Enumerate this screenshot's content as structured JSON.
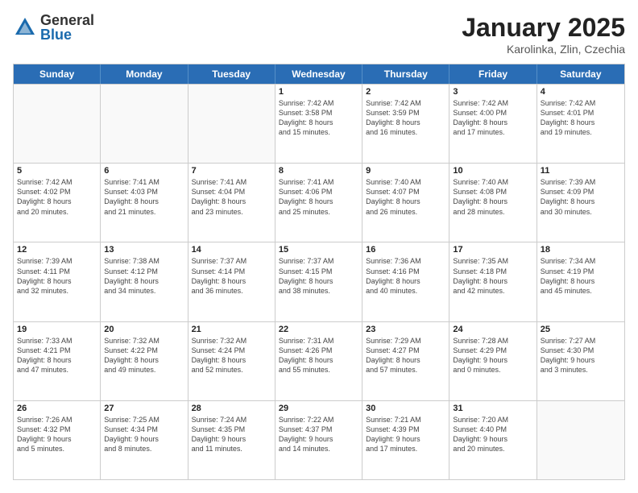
{
  "logo": {
    "general": "General",
    "blue": "Blue"
  },
  "title": "January 2025",
  "location": "Karolinka, Zlin, Czechia",
  "days": [
    "Sunday",
    "Monday",
    "Tuesday",
    "Wednesday",
    "Thursday",
    "Friday",
    "Saturday"
  ],
  "weeks": [
    [
      {
        "day": "",
        "info": ""
      },
      {
        "day": "",
        "info": ""
      },
      {
        "day": "",
        "info": ""
      },
      {
        "day": "1",
        "info": "Sunrise: 7:42 AM\nSunset: 3:58 PM\nDaylight: 8 hours\nand 15 minutes."
      },
      {
        "day": "2",
        "info": "Sunrise: 7:42 AM\nSunset: 3:59 PM\nDaylight: 8 hours\nand 16 minutes."
      },
      {
        "day": "3",
        "info": "Sunrise: 7:42 AM\nSunset: 4:00 PM\nDaylight: 8 hours\nand 17 minutes."
      },
      {
        "day": "4",
        "info": "Sunrise: 7:42 AM\nSunset: 4:01 PM\nDaylight: 8 hours\nand 19 minutes."
      }
    ],
    [
      {
        "day": "5",
        "info": "Sunrise: 7:42 AM\nSunset: 4:02 PM\nDaylight: 8 hours\nand 20 minutes."
      },
      {
        "day": "6",
        "info": "Sunrise: 7:41 AM\nSunset: 4:03 PM\nDaylight: 8 hours\nand 21 minutes."
      },
      {
        "day": "7",
        "info": "Sunrise: 7:41 AM\nSunset: 4:04 PM\nDaylight: 8 hours\nand 23 minutes."
      },
      {
        "day": "8",
        "info": "Sunrise: 7:41 AM\nSunset: 4:06 PM\nDaylight: 8 hours\nand 25 minutes."
      },
      {
        "day": "9",
        "info": "Sunrise: 7:40 AM\nSunset: 4:07 PM\nDaylight: 8 hours\nand 26 minutes."
      },
      {
        "day": "10",
        "info": "Sunrise: 7:40 AM\nSunset: 4:08 PM\nDaylight: 8 hours\nand 28 minutes."
      },
      {
        "day": "11",
        "info": "Sunrise: 7:39 AM\nSunset: 4:09 PM\nDaylight: 8 hours\nand 30 minutes."
      }
    ],
    [
      {
        "day": "12",
        "info": "Sunrise: 7:39 AM\nSunset: 4:11 PM\nDaylight: 8 hours\nand 32 minutes."
      },
      {
        "day": "13",
        "info": "Sunrise: 7:38 AM\nSunset: 4:12 PM\nDaylight: 8 hours\nand 34 minutes."
      },
      {
        "day": "14",
        "info": "Sunrise: 7:37 AM\nSunset: 4:14 PM\nDaylight: 8 hours\nand 36 minutes."
      },
      {
        "day": "15",
        "info": "Sunrise: 7:37 AM\nSunset: 4:15 PM\nDaylight: 8 hours\nand 38 minutes."
      },
      {
        "day": "16",
        "info": "Sunrise: 7:36 AM\nSunset: 4:16 PM\nDaylight: 8 hours\nand 40 minutes."
      },
      {
        "day": "17",
        "info": "Sunrise: 7:35 AM\nSunset: 4:18 PM\nDaylight: 8 hours\nand 42 minutes."
      },
      {
        "day": "18",
        "info": "Sunrise: 7:34 AM\nSunset: 4:19 PM\nDaylight: 8 hours\nand 45 minutes."
      }
    ],
    [
      {
        "day": "19",
        "info": "Sunrise: 7:33 AM\nSunset: 4:21 PM\nDaylight: 8 hours\nand 47 minutes."
      },
      {
        "day": "20",
        "info": "Sunrise: 7:32 AM\nSunset: 4:22 PM\nDaylight: 8 hours\nand 49 minutes."
      },
      {
        "day": "21",
        "info": "Sunrise: 7:32 AM\nSunset: 4:24 PM\nDaylight: 8 hours\nand 52 minutes."
      },
      {
        "day": "22",
        "info": "Sunrise: 7:31 AM\nSunset: 4:26 PM\nDaylight: 8 hours\nand 55 minutes."
      },
      {
        "day": "23",
        "info": "Sunrise: 7:29 AM\nSunset: 4:27 PM\nDaylight: 8 hours\nand 57 minutes."
      },
      {
        "day": "24",
        "info": "Sunrise: 7:28 AM\nSunset: 4:29 PM\nDaylight: 9 hours\nand 0 minutes."
      },
      {
        "day": "25",
        "info": "Sunrise: 7:27 AM\nSunset: 4:30 PM\nDaylight: 9 hours\nand 3 minutes."
      }
    ],
    [
      {
        "day": "26",
        "info": "Sunrise: 7:26 AM\nSunset: 4:32 PM\nDaylight: 9 hours\nand 5 minutes."
      },
      {
        "day": "27",
        "info": "Sunrise: 7:25 AM\nSunset: 4:34 PM\nDaylight: 9 hours\nand 8 minutes."
      },
      {
        "day": "28",
        "info": "Sunrise: 7:24 AM\nSunset: 4:35 PM\nDaylight: 9 hours\nand 11 minutes."
      },
      {
        "day": "29",
        "info": "Sunrise: 7:22 AM\nSunset: 4:37 PM\nDaylight: 9 hours\nand 14 minutes."
      },
      {
        "day": "30",
        "info": "Sunrise: 7:21 AM\nSunset: 4:39 PM\nDaylight: 9 hours\nand 17 minutes."
      },
      {
        "day": "31",
        "info": "Sunrise: 7:20 AM\nSunset: 4:40 PM\nDaylight: 9 hours\nand 20 minutes."
      },
      {
        "day": "",
        "info": ""
      }
    ]
  ]
}
